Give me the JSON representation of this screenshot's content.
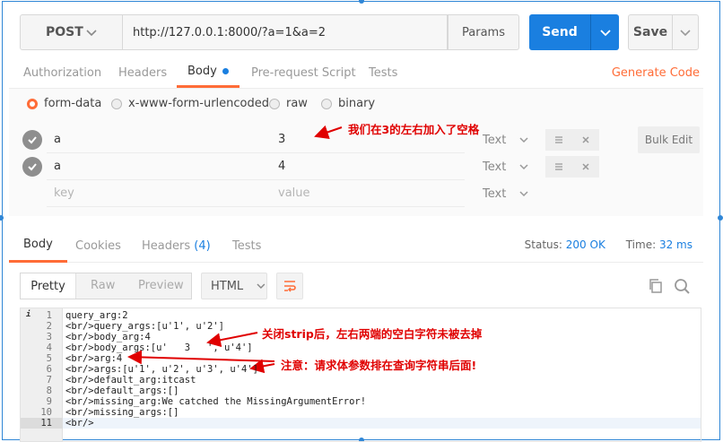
{
  "request": {
    "method": "POST",
    "url": "http://127.0.0.1:8000/?a=1&a=2",
    "params_label": "Params",
    "send_label": "Send",
    "save_label": "Save"
  },
  "request_tabs": [
    "Authorization",
    "Headers",
    "Body",
    "Pre-request Script",
    "Tests"
  ],
  "generate_code_label": "Generate Code",
  "body_modes": [
    "form-data",
    "x-www-form-urlencoded",
    "raw",
    "binary"
  ],
  "form_rows": [
    {
      "key": "a",
      "value": "3",
      "type": "Text"
    },
    {
      "key": "a",
      "value": "4",
      "type": "Text"
    },
    {
      "key": "key",
      "value": "value",
      "type": "Text"
    }
  ],
  "bulk_edit_label": "Bulk Edit",
  "annotations": {
    "note1": "我们在3的左右加入了空格",
    "note2": "关闭strip后，左右两端的空白字符未被去掉",
    "note3": "注意：请求体参数排在查询字符串后面!"
  },
  "response_tabs": {
    "body": "Body",
    "cookies": "Cookies",
    "headers": "Headers",
    "headers_count": "(4)",
    "tests": "Tests"
  },
  "status": {
    "status_label": "Status:",
    "status_value": "200 OK",
    "time_label": "Time:",
    "time_value": "32 ms"
  },
  "view_modes": [
    "Pretty",
    "Raw",
    "Preview"
  ],
  "format_label": "HTML",
  "code_lines": [
    "query_arg:2",
    "<br/>query_args:[u'1', u'2']",
    "<br/>body_arg:4",
    "<br/>body_args:[u'   3   ', u'4']",
    "<br/>arg:4",
    "<br/>args:[u'1', u'2', u'3', u'4']",
    "<br/>default_arg:itcast",
    "<br/>default_args:[]",
    "<br/>missing_arg:We catched the MissingArgumentError!",
    "<br/>missing_args:[]",
    "<br/>"
  ],
  "colors": {
    "accent": "#ff6c37",
    "primary": "#1a7fe0",
    "annotation": "#e00000"
  }
}
